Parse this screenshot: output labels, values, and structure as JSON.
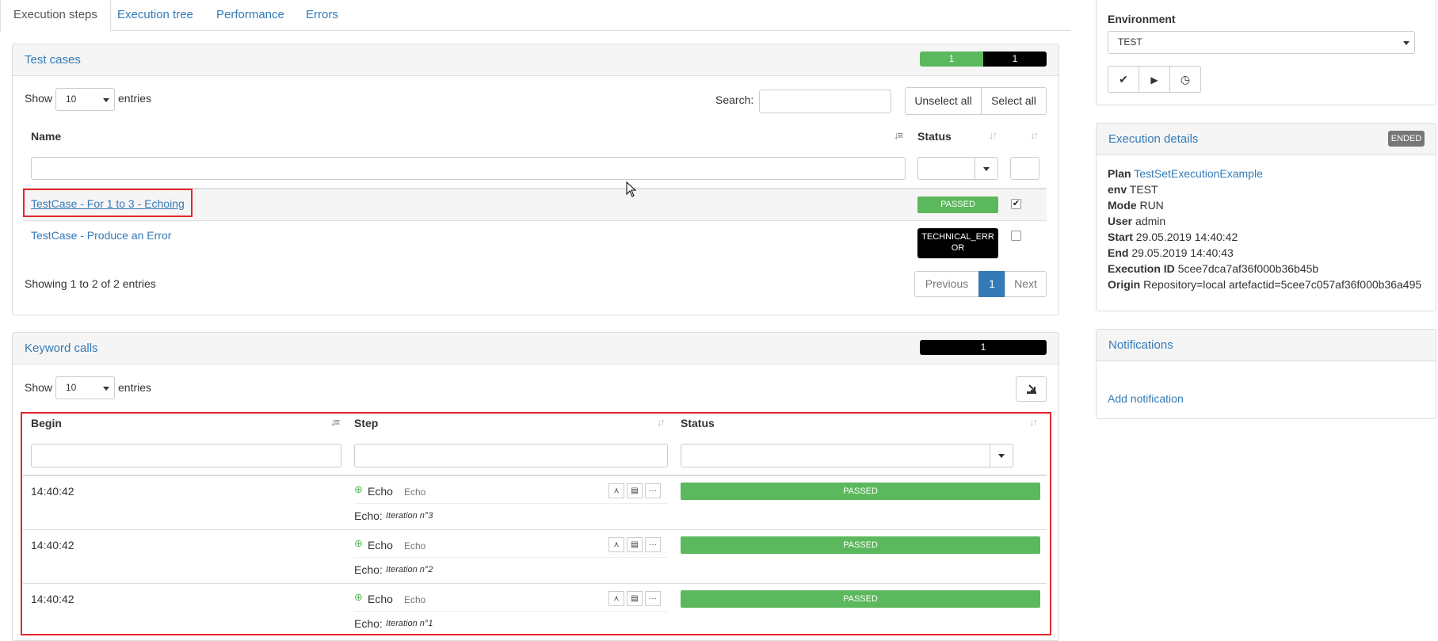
{
  "tabs": [
    {
      "label": "Execution steps",
      "active": true
    },
    {
      "label": "Execution tree"
    },
    {
      "label": "Performance"
    },
    {
      "label": "Errors"
    }
  ],
  "testcases": {
    "title": "Test cases",
    "counter_passed": "1",
    "counter_error": "1",
    "show_label": "Show",
    "entries_label": "entries",
    "page_size": "10",
    "search_label": "Search:",
    "unselect_all": "Unselect all",
    "select_all": "Select all",
    "col_name": "Name",
    "col_status": "Status",
    "rows": [
      {
        "name": "TestCase - For 1 to 3 - Echoing",
        "status": "PASSED",
        "checked": true
      },
      {
        "name": "TestCase - Produce an Error",
        "status_line1": "TECHNICAL_ERR",
        "status_line2": "OR",
        "checked": false
      }
    ],
    "info": "Showing 1 to 2 of 2 entries",
    "prev": "Previous",
    "page": "1",
    "next": "Next"
  },
  "keywords": {
    "title": "Keyword calls",
    "counter": "1",
    "show_label": "Show",
    "entries_label": "entries",
    "page_size": "10",
    "col_begin": "Begin",
    "col_step": "Step",
    "col_status": "Status",
    "rows": [
      {
        "begin": "14:40:42",
        "step": "Echo",
        "step_type": "Echo",
        "detail_label": "Echo:",
        "detail_value": "Iteration n°3",
        "status": "PASSED"
      },
      {
        "begin": "14:40:42",
        "step": "Echo",
        "step_type": "Echo",
        "detail_label": "Echo:",
        "detail_value": "Iteration n°2",
        "status": "PASSED"
      },
      {
        "begin": "14:40:42",
        "step": "Echo",
        "step_type": "Echo",
        "detail_label": "Echo:",
        "detail_value": "Iteration n°1",
        "status": "PASSED"
      }
    ]
  },
  "environment": {
    "label": "Environment",
    "value": "TEST"
  },
  "execution": {
    "title": "Execution details",
    "state": "ENDED",
    "plan_label": "Plan",
    "plan_value": "TestSetExecutionExample",
    "env_label": "env",
    "env_value": "TEST",
    "mode_label": "Mode",
    "mode_value": "RUN",
    "user_label": "User",
    "user_value": "admin",
    "start_label": "Start",
    "start_value": "29.05.2019 14:40:42",
    "end_label": "End",
    "end_value": "29.05.2019 14:40:43",
    "id_label": "Execution ID",
    "id_value": "5cee7dca7af36f000b36b45b",
    "origin_label": "Origin",
    "origin_value": "Repository=local artefactid=5cee7c057af36f000b36a495"
  },
  "notifications": {
    "title": "Notifications",
    "add": "Add notification"
  },
  "colors": {
    "link": "#337ab7",
    "passed": "#5cb85c",
    "error": "#000000",
    "highlight": "#e4262d"
  }
}
